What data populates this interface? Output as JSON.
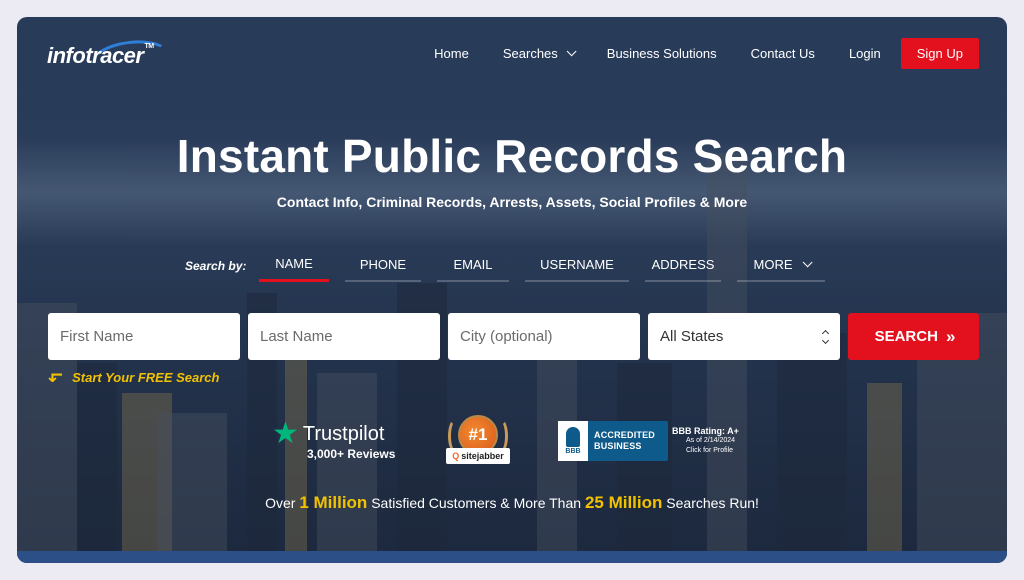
{
  "header": {
    "logo_info": "info",
    "logo_tracer": "tracer",
    "logo_tm": "TM",
    "nav": [
      {
        "label": "Home"
      },
      {
        "label": "Searches"
      },
      {
        "label": "Business Solutions"
      },
      {
        "label": "Contact Us"
      },
      {
        "label": "Login"
      }
    ],
    "signup_label": "Sign Up"
  },
  "hero": {
    "title": "Instant Public Records Search",
    "subtitle": "Contact Info, Criminal Records, Arrests, Assets, Social Profiles & More"
  },
  "search": {
    "by_label": "Search by:",
    "tabs": [
      {
        "label": "NAME",
        "active": true
      },
      {
        "label": "PHONE"
      },
      {
        "label": "EMAIL"
      },
      {
        "label": "USERNAME"
      },
      {
        "label": "ADDRESS"
      },
      {
        "label": "MORE"
      }
    ],
    "first_name_placeholder": "First Name",
    "last_name_placeholder": "Last Name",
    "city_placeholder": "City (optional)",
    "state_selected": "All States",
    "search_label": "SEARCH",
    "search_chevrons": "»",
    "free_arrow": "↱",
    "free_text": "Start Your FREE Search"
  },
  "badges": {
    "trustpilot_star": "★",
    "trustpilot_name": "Trustpilot",
    "trustpilot_reviews": "3,000+ Reviews",
    "sitejabber_rank": "#1",
    "sitejabber_name": "sitejabber",
    "bbb_short": "BBB",
    "bbb_accredited_line1": "ACCREDITED",
    "bbb_accredited_line2": "BUSINESS",
    "bbb_rating": "BBB Rating: A+",
    "bbb_asof": "As of 2/14/2024",
    "bbb_click": "Click for Profile"
  },
  "stats": {
    "pre": "Over",
    "customers_value": "1 Million",
    "mid": "Satisfied Customers & More Than",
    "searches_value": "25 Million",
    "post": "Searches Run!"
  },
  "colors": {
    "accent_red": "#e3101e",
    "highlight_yellow": "#f2c200",
    "trustpilot_green": "#00b67a",
    "bbb_blue": "#0e5a8a"
  }
}
